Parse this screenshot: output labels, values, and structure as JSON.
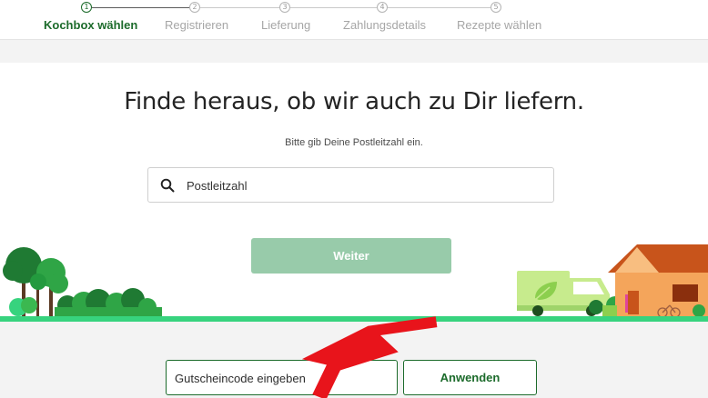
{
  "stepper": {
    "steps": [
      {
        "number": "1",
        "label": "Kochbox wählen",
        "active": true
      },
      {
        "number": "2",
        "label": "Registrieren",
        "active": false
      },
      {
        "number": "3",
        "label": "Lieferung",
        "active": false
      },
      {
        "number": "4",
        "label": "Zahlungsdetails",
        "active": false
      },
      {
        "number": "5",
        "label": "Rezepte wählen",
        "active": false
      }
    ]
  },
  "main": {
    "headline": "Finde heraus, ob wir auch zu Dir liefern.",
    "subtitle": "Bitte gib Deine Postleitzahl ein.",
    "zip_placeholder": "Postleitzahl",
    "submit_label": "Weiter"
  },
  "voucher": {
    "placeholder": "Gutscheincode eingeben",
    "apply_label": "Anwenden"
  },
  "colors": {
    "brand_green": "#1c6b2b",
    "disabled_button": "#98cbaa",
    "ground": "#37d37e",
    "annotation_arrow": "#e8141b"
  },
  "icons": {
    "search": "search-icon"
  }
}
